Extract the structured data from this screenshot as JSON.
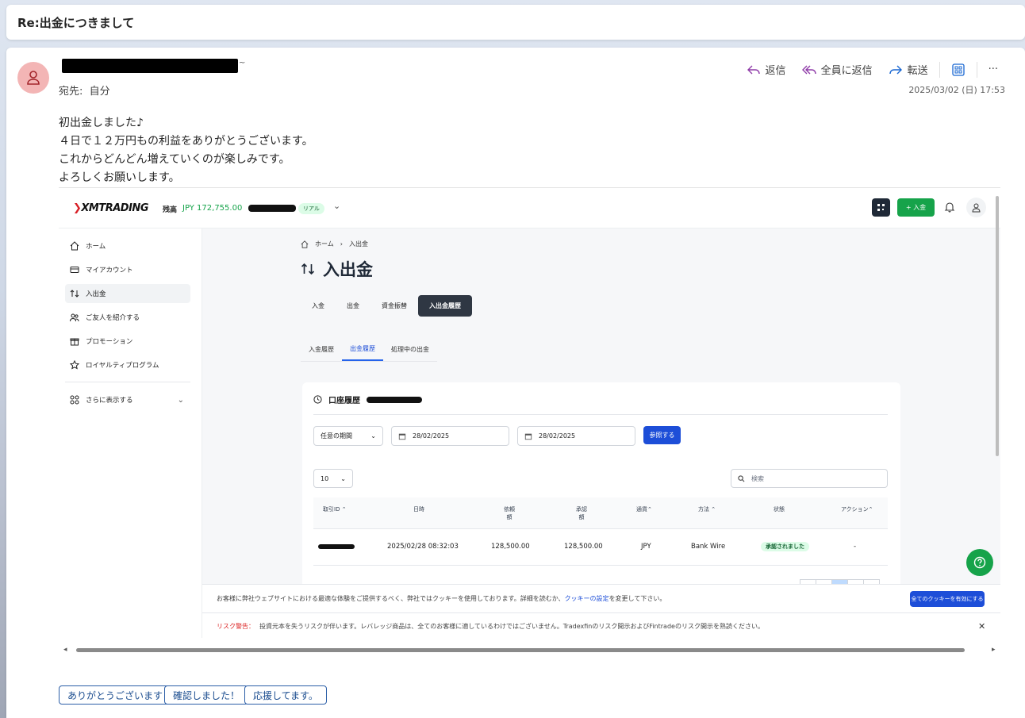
{
  "subject": "Re:出金につきまして",
  "sender": {
    "name_tail": "~"
  },
  "to": {
    "label": "宛先:",
    "value": "自分"
  },
  "actions": {
    "reply": "返信",
    "reply_all": "全員に返信",
    "forward": "転送",
    "more": "···"
  },
  "datetime": "2025/03/02 (日) 17:53",
  "body": [
    "初出金しました♪",
    "４日で１２万円もの利益をありがとうございます。",
    "これからどんどん増えていくのが楽しみです。",
    "よろしくお願いします。"
  ],
  "xm": {
    "logo": "XMTRADING",
    "balance_label": "残高",
    "balance_value": "JPY 172,755.00",
    "account_badge": "リアル",
    "deposit_button": "+ 入金",
    "sidebar": {
      "items": [
        {
          "label": "ホーム"
        },
        {
          "label": "マイアカウント"
        },
        {
          "label": "入出金"
        },
        {
          "label": "ご友人を紹介する"
        },
        {
          "label": "プロモーション"
        },
        {
          "label": "ロイヤルティプログラム"
        }
      ],
      "more": "さらに表示する"
    },
    "breadcrumb": {
      "home": "ホーム",
      "current": "入出金"
    },
    "page_title": "入出金",
    "tabs": [
      "入金",
      "出金",
      "資金振替",
      "入出金履歴"
    ],
    "subtabs": [
      "入金履歴",
      "出金履歴",
      "処理中の出金"
    ],
    "panel": {
      "title": "口座履歴",
      "period": "任意の期間",
      "date_from": "28/02/2025",
      "date_to": "28/02/2025",
      "search_button": "参照する",
      "page_size": "10",
      "search_placeholder": "検索"
    },
    "table": {
      "headers": [
        "取引ID",
        "日時",
        "依頼額",
        "承認額",
        "通貨",
        "方法",
        "状態",
        "アクション"
      ],
      "row": {
        "datetime": "2025/02/28 08:32:03",
        "requested": "128,500.00",
        "approved": "128,500.00",
        "currency": "JPY",
        "method": "Bank Wire",
        "status": "承認されました",
        "action": "-"
      }
    },
    "cookie": {
      "text": "お客様に弊社ウェブサイトにおける最適な体験をご提供するべく、弊社ではクッキーを使用しております。詳細を読むか、",
      "link": "クッキーの設定",
      "text_after": "を変更して下さい。",
      "button": "全てのクッキーを有効にする"
    },
    "risk": {
      "label": "リスク警告：",
      "text": "投資元本を失うリスクが伴います。レバレッジ商品は、全てのお客様に適しているわけではございません。Tradexfinのリスク開示およびFintradeのリスク開示を熟読ください。"
    }
  },
  "quick_replies": [
    "ありがとうございます！",
    "確認しました！",
    "応援してます。"
  ],
  "colors": {
    "accent_green": "#16a34a",
    "link_blue": "#1d4ed8",
    "avatar_bg": "#f3b5b5"
  }
}
